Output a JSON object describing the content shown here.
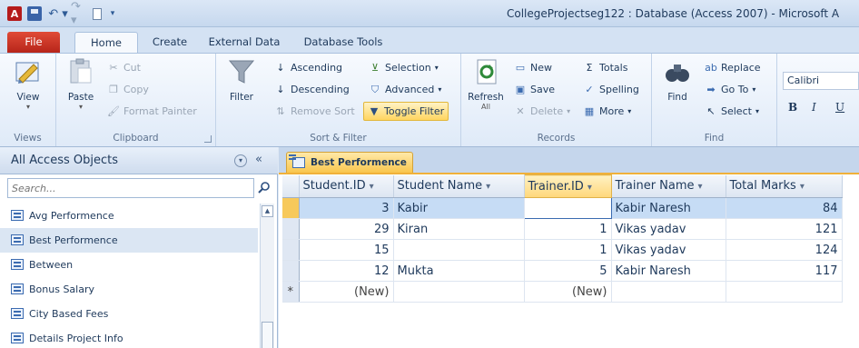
{
  "window": {
    "title": "CollegeProjectseg122 : Database (Access 2007) - Microsoft A"
  },
  "quick_access": {
    "app_icon_label": "A",
    "undo_glyph": "↶ ▾",
    "redo_glyph": "↷ ▾",
    "more_glyph": "▾"
  },
  "tabs": {
    "file": "File",
    "home": "Home",
    "create": "Create",
    "external": "External Data",
    "dbtools": "Database Tools"
  },
  "ribbon": {
    "views": {
      "label": "Views",
      "view_button": "View"
    },
    "clipboard": {
      "label": "Clipboard",
      "paste": "Paste",
      "cut": "Cut",
      "copy": "Copy",
      "format_painter": "Format Painter"
    },
    "sort_filter": {
      "label": "Sort & Filter",
      "filter": "Filter",
      "ascending": "Ascending",
      "descending": "Descending",
      "remove_sort": "Remove Sort",
      "selection": "Selection",
      "advanced": "Advanced",
      "toggle_filter": "Toggle Filter"
    },
    "records": {
      "label": "Records",
      "refresh": "Refresh",
      "refresh_sub": "All",
      "new": "New",
      "save": "Save",
      "delete": "Delete",
      "totals": "Totals",
      "spelling": "Spelling",
      "more": "More"
    },
    "find": {
      "label": "Find",
      "find": "Find",
      "replace": "Replace",
      "goto": "Go To",
      "select": "Select"
    },
    "text_format": {
      "font": "Calibri",
      "bold": "B",
      "italic": "I",
      "underline": "U"
    }
  },
  "nav": {
    "title": "All Access Objects",
    "search_placeholder": "Search...",
    "items": [
      {
        "label": "Avg Performence"
      },
      {
        "label": "Best Performence"
      },
      {
        "label": "Between"
      },
      {
        "label": "Bonus Salary"
      },
      {
        "label": "City Based Fees"
      },
      {
        "label": "Details Project Info"
      }
    ]
  },
  "document": {
    "tab_title": "Best Performence",
    "columns": [
      "Student.ID",
      "Student Name",
      "Trainer.ID",
      "Trainer Name",
      "Total Marks"
    ],
    "rows": [
      {
        "student_id": "3",
        "student_name": "Kabir",
        "trainer_id": "",
        "trainer_name": "Kabir Naresh",
        "total_marks": "84"
      },
      {
        "student_id": "29",
        "student_name": "Kiran",
        "trainer_id": "1",
        "trainer_name": "Vikas yadav",
        "total_marks": "121"
      },
      {
        "student_id": "15",
        "student_name": "",
        "trainer_id": "1",
        "trainer_name": "Vikas yadav",
        "total_marks": "124"
      },
      {
        "student_id": "12",
        "student_name": "Mukta",
        "trainer_id": "5",
        "trainer_name": "Kabir Naresh",
        "total_marks": "117"
      }
    ],
    "new_row": {
      "marker": "*",
      "student_id": "(New)",
      "trainer_id": "(New)"
    }
  }
}
